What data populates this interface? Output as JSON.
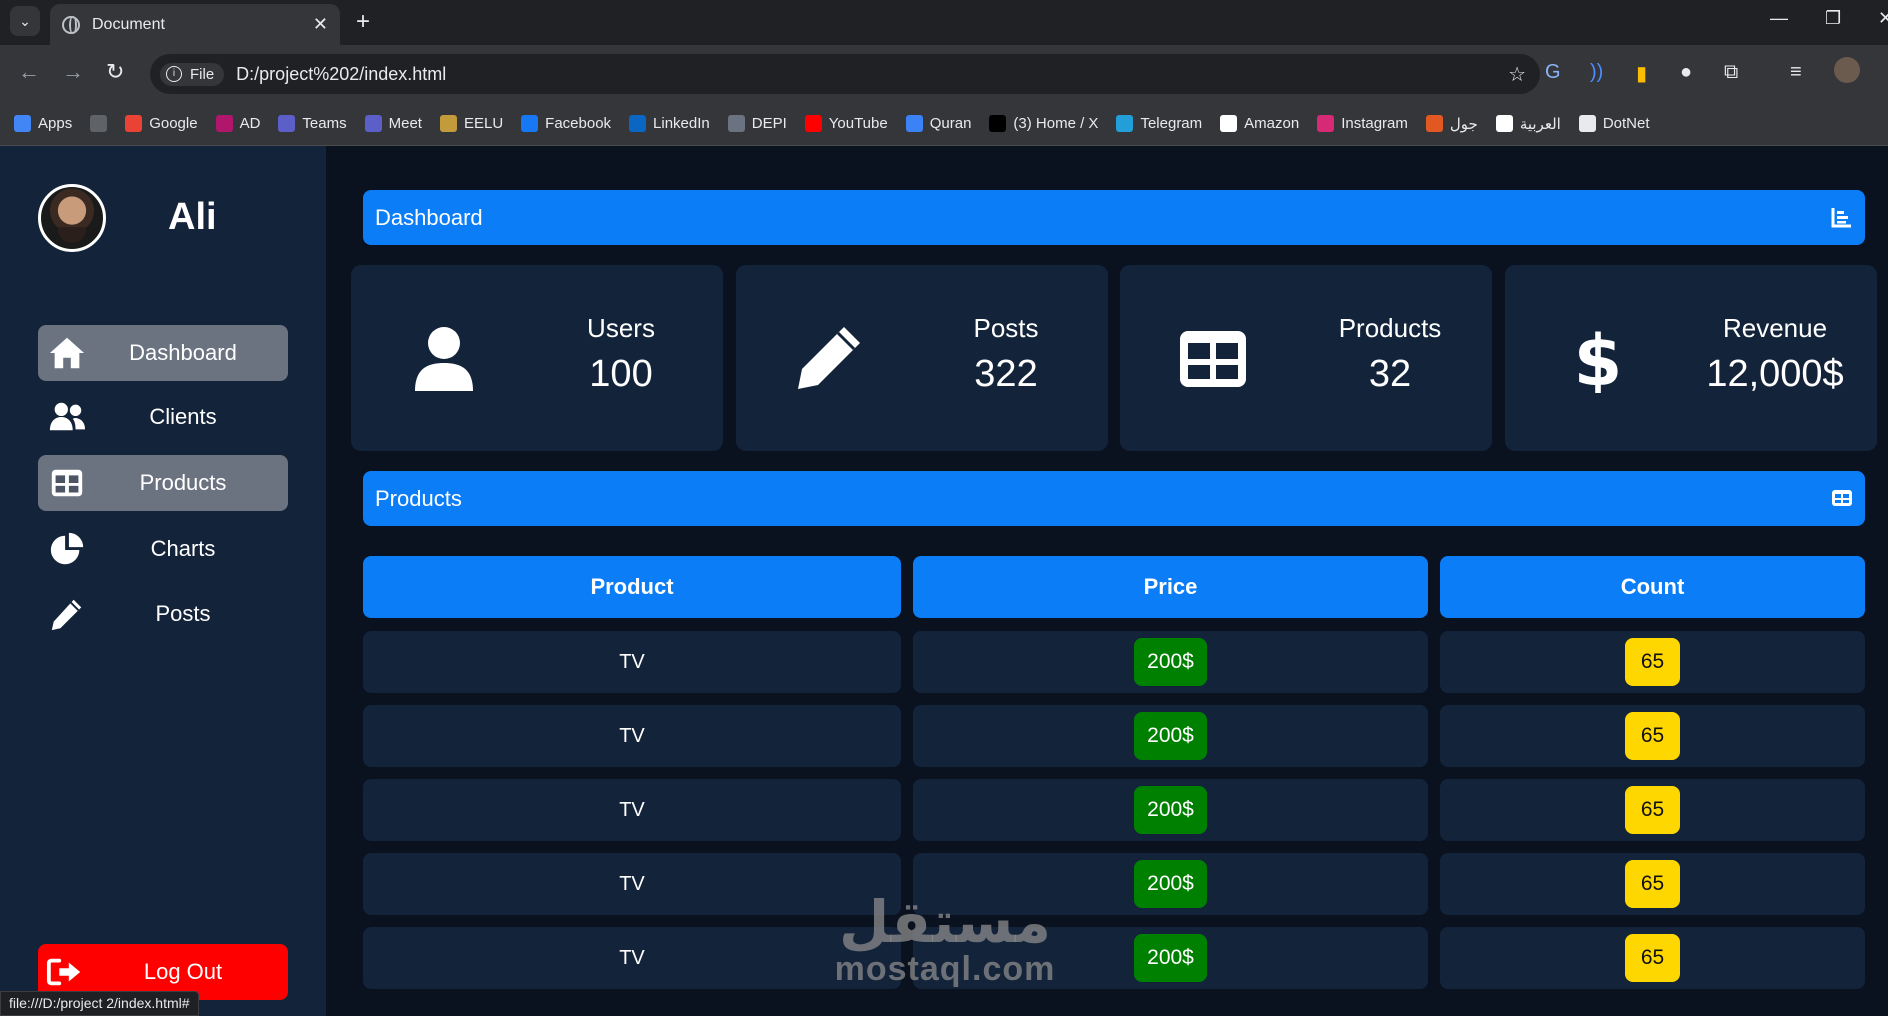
{
  "browser": {
    "tab_title": "Document",
    "tab_close": "✕",
    "new_tab": "+",
    "omnibox_chip": "File",
    "url": "D:/project%202/index.html",
    "status_url": "file:///D:/project 2/index.html#",
    "bookmarks": [
      {
        "label": "Apps",
        "icon": "apps-grid-icon",
        "color": "#4285f4"
      },
      {
        "label": "",
        "icon": "tab-groups-icon",
        "color": "#5f6368"
      },
      {
        "label": "Google",
        "icon": "google-icon",
        "color": "#ea4335"
      },
      {
        "label": "AD",
        "icon": "ad-icon",
        "color": "#b0176c"
      },
      {
        "label": "Teams",
        "icon": "teams-icon",
        "color": "#5b5fc7"
      },
      {
        "label": "Meet",
        "icon": "meet-icon",
        "color": "#5b5fc7"
      },
      {
        "label": "EELU",
        "icon": "eelu-icon",
        "color": "#c29b3a"
      },
      {
        "label": "Facebook",
        "icon": "facebook-icon",
        "color": "#1877f2"
      },
      {
        "label": "LinkedIn",
        "icon": "linkedin-icon",
        "color": "#0a66c2"
      },
      {
        "label": "DEPI",
        "icon": "depi-icon",
        "color": "#6b7280"
      },
      {
        "label": "YouTube",
        "icon": "youtube-icon",
        "color": "#ff0000"
      },
      {
        "label": "Quran",
        "icon": "quran-icon",
        "color": "#3b82f6"
      },
      {
        "label": "(3) Home / X",
        "icon": "x-icon",
        "color": "#000000"
      },
      {
        "label": "Telegram",
        "icon": "telegram-icon",
        "color": "#229ed9"
      },
      {
        "label": "Amazon",
        "icon": "amazon-icon",
        "color": "#ffffff"
      },
      {
        "label": "Instagram",
        "icon": "instagram-icon",
        "color": "#d62976"
      },
      {
        "label": "جول",
        "icon": "goal-icon",
        "color": "#e25822"
      },
      {
        "label": "العربية",
        "icon": "alarabiya-icon",
        "color": "#ffffff"
      },
      {
        "label": "DotNet",
        "icon": "folder-icon",
        "color": "#e8eaed"
      }
    ]
  },
  "user": {
    "name": "Ali"
  },
  "nav": {
    "items": [
      {
        "label": "Dashboard",
        "icon": "home-icon",
        "active": true
      },
      {
        "label": "Clients",
        "icon": "users-icon",
        "active": false
      },
      {
        "label": "Products",
        "icon": "table-icon",
        "active": true
      },
      {
        "label": "Charts",
        "icon": "pie-chart-icon",
        "active": false
      },
      {
        "label": "Posts",
        "icon": "pencil-icon",
        "active": false
      }
    ],
    "logout": "Log Out"
  },
  "sections": {
    "dashboard": "Dashboard",
    "products": "Products"
  },
  "stats": [
    {
      "label": "Users",
      "value": "100",
      "icon": "user-icon"
    },
    {
      "label": "Posts",
      "value": "322",
      "icon": "pencil-icon"
    },
    {
      "label": "Products",
      "value": "32",
      "icon": "table-icon"
    },
    {
      "label": "Revenue",
      "value": "12,000$",
      "icon": "dollar-icon"
    }
  ],
  "table": {
    "headers": [
      "Product",
      "Price",
      "Count"
    ],
    "rows": [
      {
        "product": "TV",
        "price": "200$",
        "count": "65"
      },
      {
        "product": "TV",
        "price": "200$",
        "count": "65"
      },
      {
        "product": "TV",
        "price": "200$",
        "count": "65"
      },
      {
        "product": "TV",
        "price": "200$",
        "count": "65"
      },
      {
        "product": "TV",
        "price": "200$",
        "count": "65"
      }
    ]
  },
  "colors": {
    "accent": "#0a7df7",
    "panel": "#13233a",
    "background": "#0a1220",
    "active_nav": "#6b7280",
    "logout": "#ff0000",
    "price_badge": "#008000",
    "count_badge": "#ffd700"
  }
}
